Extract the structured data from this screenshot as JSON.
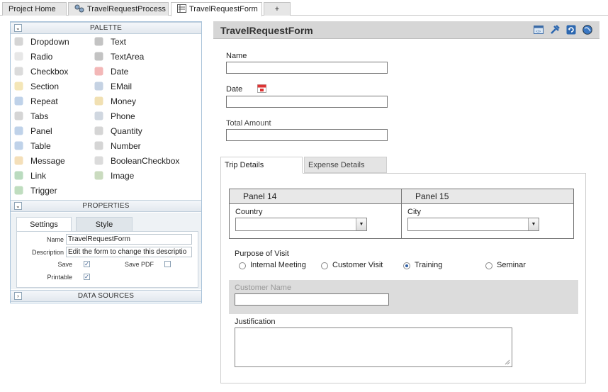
{
  "tabs": [
    {
      "label": "Project Home"
    },
    {
      "label": "TravelRequestProcess"
    },
    {
      "label": "TravelRequestForm"
    },
    {
      "label": "+"
    }
  ],
  "palette": {
    "title": "PALETTE",
    "left": [
      "Dropdown",
      "Radio",
      "Checkbox",
      "Section",
      "Repeat",
      "Tabs",
      "Panel",
      "Table",
      "Message",
      "Link",
      "Trigger"
    ],
    "right": [
      "Text",
      "TextArea",
      "Date",
      "EMail",
      "Money",
      "Phone",
      "Quantity",
      "Number",
      "BooleanCheckbox",
      "Image"
    ]
  },
  "properties": {
    "title": "PROPERTIES",
    "tab_settings": "Settings",
    "tab_style": "Style",
    "name_label": "Name",
    "name_value": "TravelRequestForm",
    "desc_label": "Description",
    "desc_value": "Edit the form to change this descriptio",
    "save_label": "Save",
    "savepdf_label": "Save PDF",
    "printable_label": "Printable"
  },
  "datasources": {
    "title": "DATA SOURCES"
  },
  "form": {
    "title": "TravelRequestForm",
    "name_label": "Name",
    "date_label": "Date",
    "total_label": "Total Amount",
    "tab_trip": "Trip Details",
    "tab_expense": "Expense Details",
    "panel14": "Panel 14",
    "panel15": "Panel 15",
    "country_label": "Country",
    "city_label": "City",
    "purpose_label": "Purpose of Visit",
    "purpose_options": [
      "Internal Meeting",
      "Customer Visit",
      "Training",
      "Seminar"
    ],
    "purpose_selected": "Training",
    "customer_label": "Customer Name",
    "justification_label": "Justification"
  },
  "colors": {
    "accent": "#2f5fa5",
    "panel_border": "#a9c3da",
    "header_bg": "#d6d6d6"
  }
}
